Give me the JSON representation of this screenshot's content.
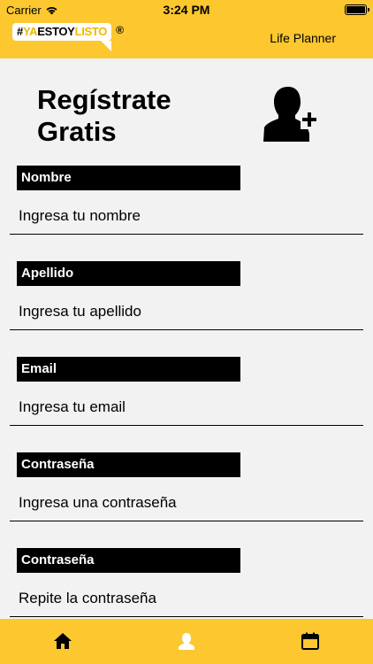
{
  "status_bar": {
    "carrier": "Carrier",
    "time": "3:24 PM"
  },
  "header": {
    "logo_hash": "#",
    "logo_ya": "YA",
    "logo_estoy": "ESTOY",
    "logo_listo": "LISTO",
    "logo_reg": "®",
    "title": "Life Planner"
  },
  "page": {
    "title_line1": "Regístrate",
    "title_line2": "Gratis",
    "icon": "add-user-icon"
  },
  "form": {
    "fields": [
      {
        "label": "Nombre",
        "placeholder": "Ingresa tu nombre"
      },
      {
        "label": "Apellido",
        "placeholder": "Ingresa tu apellido"
      },
      {
        "label": "Email",
        "placeholder": "Ingresa tu email"
      },
      {
        "label": "Contraseña",
        "placeholder": "Ingresa una contraseña"
      },
      {
        "label": "Contraseña",
        "placeholder": "Repite la contraseña"
      }
    ]
  },
  "tab_bar": {
    "tabs": [
      {
        "icon": "home-icon",
        "active": true
      },
      {
        "icon": "user-icon",
        "active": false
      },
      {
        "icon": "calendar-icon",
        "active": false
      }
    ]
  },
  "colors": {
    "brand_yellow": "#fcc72f",
    "background": "#f2f2f2",
    "label_background": "#000000",
    "label_text": "#ffffff",
    "inactive_tab_icon": "#ffffff"
  }
}
